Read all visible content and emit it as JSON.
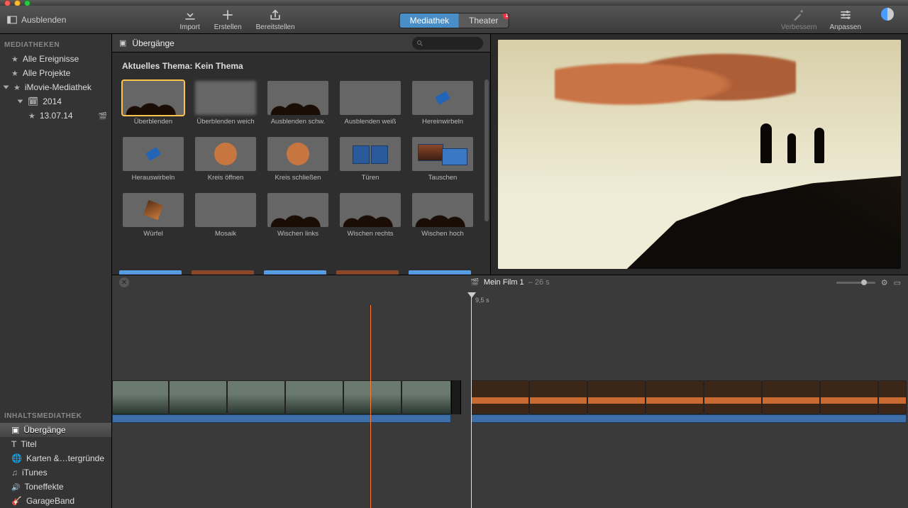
{
  "toolbar": {
    "hide": "Ausblenden",
    "import": "Import",
    "create": "Erstellen",
    "share": "Bereitstellen",
    "tabs": {
      "library": "Mediathek",
      "theater": "Theater",
      "badge": "1"
    },
    "enhance": "Verbessern",
    "adjust": "Anpassen"
  },
  "sidebar": {
    "header_libraries": "MEDIATHEKEN",
    "all_events": "Alle Ereignisse",
    "all_projects": "Alle Projekte",
    "imovie_library": "iMovie-Mediathek",
    "year": "2014",
    "event": "13.07.14",
    "header_content": "INHALTSMEDIATHEK",
    "content_items": {
      "transitions": "Übergänge",
      "titles": "Titel",
      "maps": "Karten &…tergründe",
      "itunes": "iTunes",
      "sound_effects": "Toneffekte",
      "garageband": "GarageBand"
    }
  },
  "browser": {
    "title": "Übergänge",
    "subhead": "Aktuelles Thema: Kein Thema",
    "search_placeholder": "",
    "transitions": [
      {
        "id": "uberblenden",
        "label": "Überblenden",
        "art": "art-trees",
        "selected": true
      },
      {
        "id": "uberblenden-weich",
        "label": "Überblenden weich",
        "art": "art-blur"
      },
      {
        "id": "ausblenden-schw",
        "label": "Ausblenden schw.",
        "art": "art-trees"
      },
      {
        "id": "ausblenden-weiss",
        "label": "Ausblenden weiß",
        "art": "art-pink"
      },
      {
        "id": "hereinwirbeln",
        "label": "Hereinwirbeln",
        "art": "art-trees art-spin"
      },
      {
        "id": "herauswirbeln",
        "label": "Herauswirbeln",
        "art": "art-blue art-spin"
      },
      {
        "id": "kreis-oeffnen",
        "label": "Kreis öffnen",
        "art": "art-blue art-circle"
      },
      {
        "id": "kreis-schliessen",
        "label": "Kreis schließen",
        "art": "art-trees art-circle"
      },
      {
        "id": "tueren",
        "label": "Türen",
        "art": "art-blue art-doors"
      },
      {
        "id": "tauschen",
        "label": "Tauschen",
        "art": "art-blue art-swap"
      },
      {
        "id": "wuerfel",
        "label": "Würfel",
        "art": "art-cube"
      },
      {
        "id": "mosaik",
        "label": "Mosaik",
        "art": "art-mosaic"
      },
      {
        "id": "wischen-links",
        "label": "Wischen links",
        "art": "art-trees"
      },
      {
        "id": "wischen-rechts",
        "label": "Wischen rechts",
        "art": "art-trees"
      },
      {
        "id": "wischen-hoch",
        "label": "Wischen hoch",
        "art": "art-trees"
      }
    ]
  },
  "timeline": {
    "project_name": "Mein Film 1",
    "duration": "– 26 s",
    "playhead_time": "9,5 s"
  }
}
